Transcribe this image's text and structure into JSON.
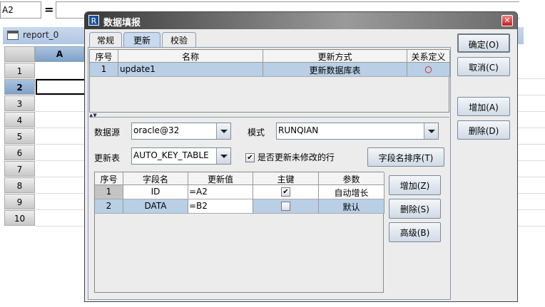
{
  "formula_bar": {
    "cell_ref": "A2",
    "equals": "=",
    "formula": ""
  },
  "sheet": {
    "title": "report_0",
    "column_header": "A",
    "rows": [
      "1",
      "2",
      "3",
      "4",
      "5",
      "6",
      "7",
      "8",
      "9",
      "10"
    ],
    "selected_row": "2"
  },
  "dialog": {
    "title": "数据填报",
    "logo": "R",
    "close": "✕",
    "tabs": [
      {
        "label": "常规"
      },
      {
        "label": "更新",
        "active": true
      },
      {
        "label": "校验"
      }
    ],
    "update_table": {
      "headers": [
        "序号",
        "名称",
        "更新方式",
        "关系定义"
      ],
      "rows": [
        {
          "no": "1",
          "name": "update1",
          "mode": "更新数据库表",
          "relation": "○"
        }
      ]
    },
    "form": {
      "datasource_label": "数据源",
      "datasource_value": "oracle@32",
      "schema_label": "模式",
      "schema_value": "RUNQIAN",
      "table_label": "更新表",
      "table_value": "AUTO_KEY_TABLE",
      "update_unmodified_label": "是否更新未修改的行",
      "update_unmodified_checked": true,
      "sort_button": "字段名排序(T)"
    },
    "field_table": {
      "headers": [
        "序号",
        "字段名",
        "更新值",
        "主键",
        "参数"
      ],
      "rows": [
        {
          "no": "1",
          "field": "ID",
          "value": "=A2",
          "key": true,
          "param": "自动增长"
        },
        {
          "no": "2",
          "field": "DATA",
          "value": "=B2",
          "key": false,
          "param": "默认"
        }
      ]
    },
    "field_buttons": {
      "add": "增加(Z)",
      "delete": "删除(S)",
      "advanced": "高级(B)"
    },
    "side_buttons": {
      "ok": "确定(O)",
      "cancel": "取消(C)",
      "add": "增加(A)",
      "delete": "删除(D)"
    },
    "check_mark": "✔"
  }
}
